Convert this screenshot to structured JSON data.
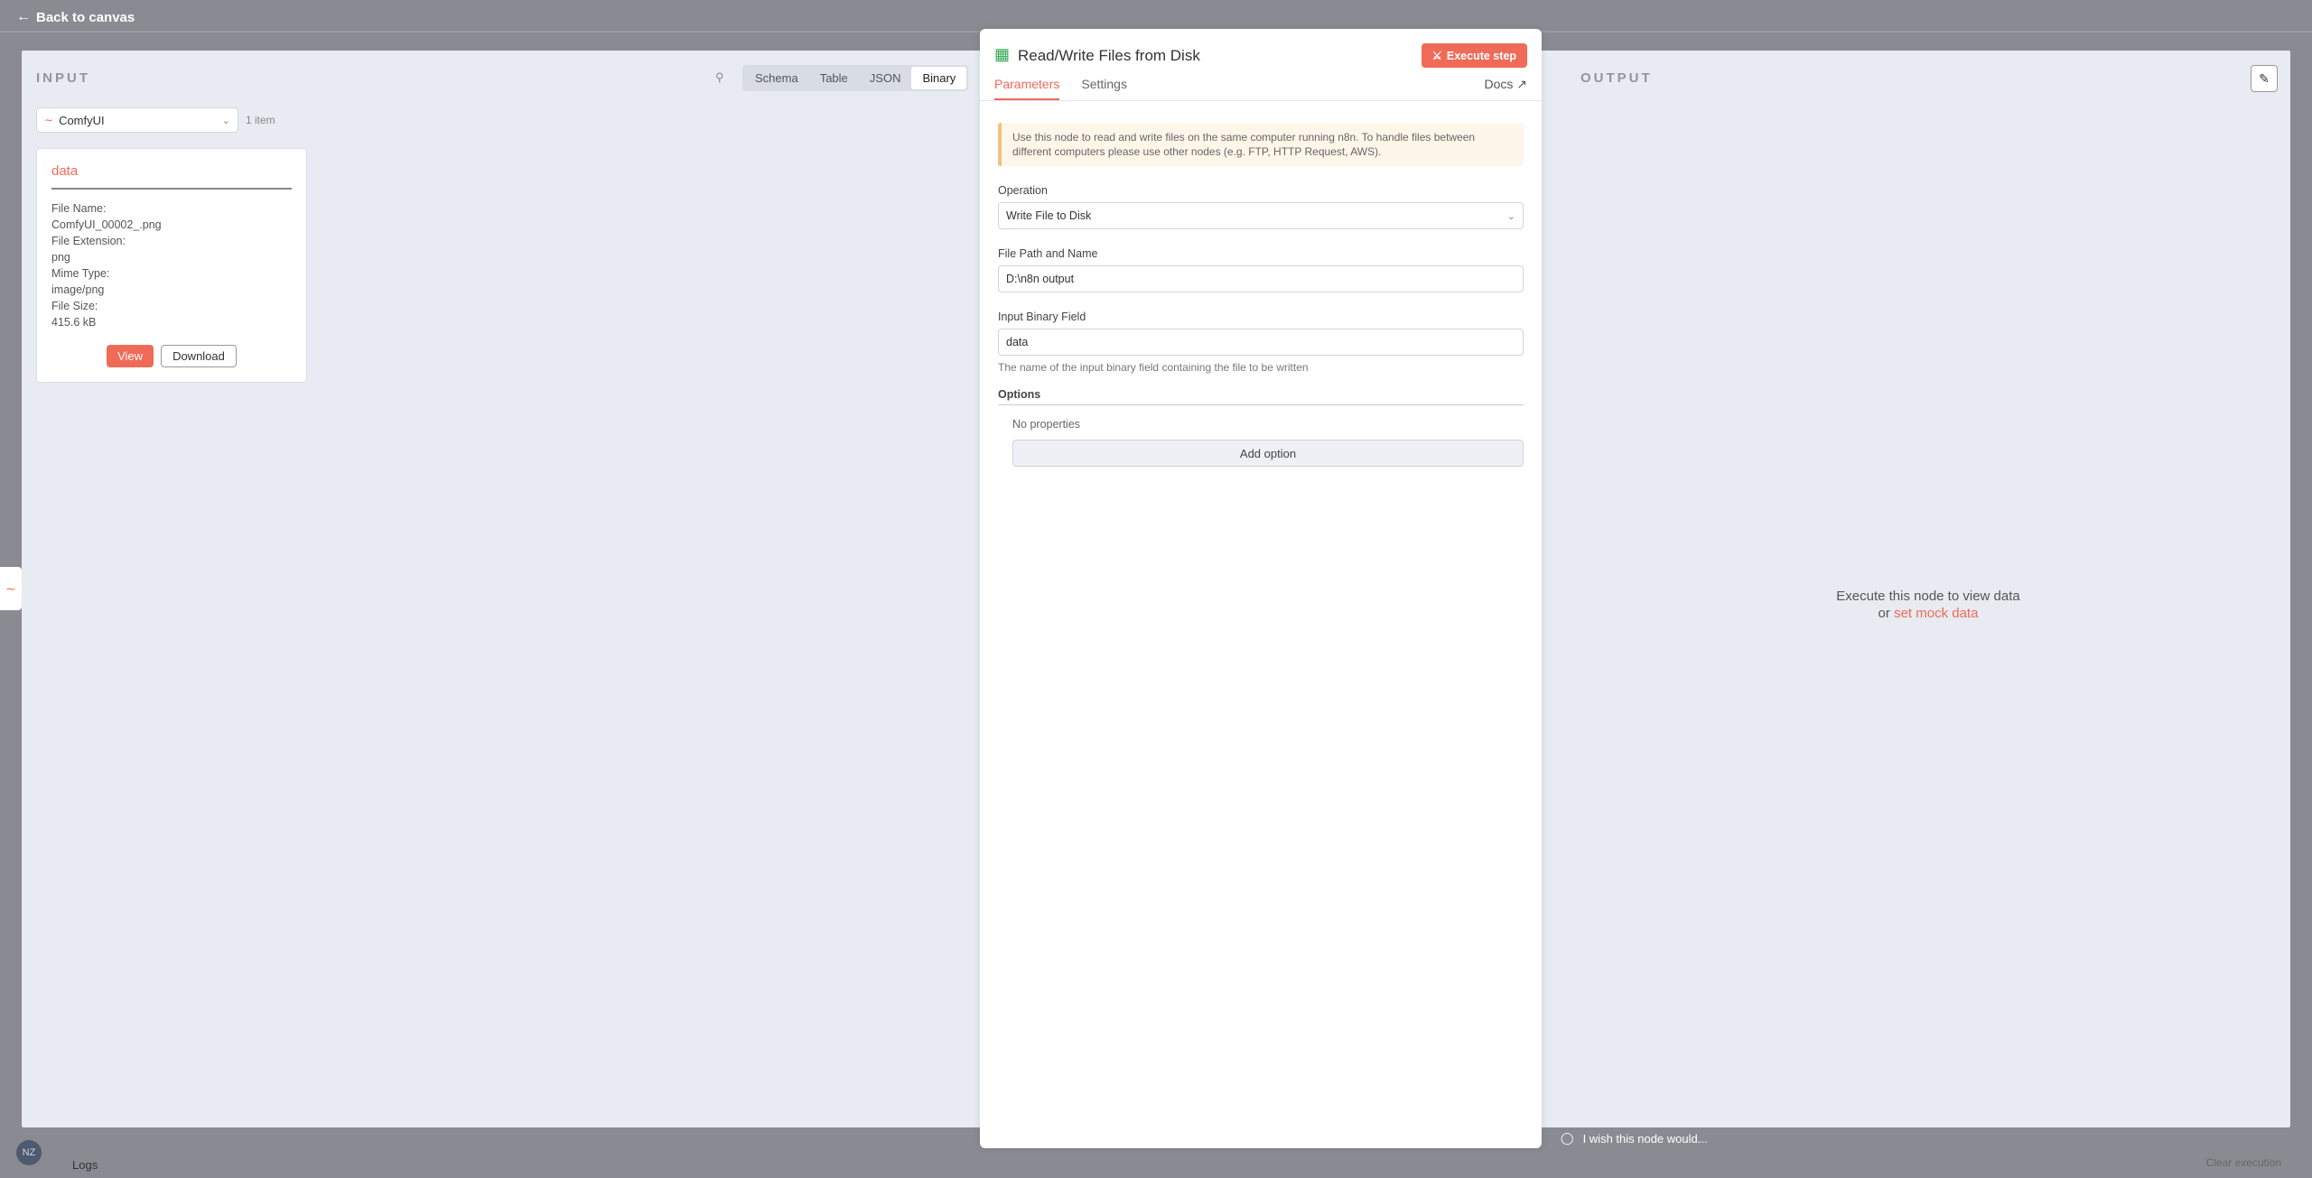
{
  "nav": {
    "back_label": "Back to canvas"
  },
  "input": {
    "title": "INPUT",
    "view_tabs": [
      "Schema",
      "Table",
      "JSON",
      "Binary"
    ],
    "active_tab": "Binary",
    "node_select": "ComfyUI",
    "items_count": "1 item",
    "card": {
      "title": "data",
      "file_name_label": "File Name:",
      "file_name": "ComfyUI_00002_.png",
      "file_ext_label": "File Extension:",
      "file_ext": "png",
      "mime_label": "Mime Type:",
      "mime": "image/png",
      "size_label": "File Size:",
      "size": "415.6 kB",
      "view_label": "View",
      "download_label": "Download"
    }
  },
  "params": {
    "node_title": "Read/Write Files from Disk",
    "execute_label": "Execute step",
    "tab_parameters": "Parameters",
    "tab_settings": "Settings",
    "docs_label": "Docs",
    "notice": "Use this node to read and write files on the same computer running n8n. To handle files between different computers please use other nodes (e.g. FTP, HTTP Request, AWS).",
    "operation_label": "Operation",
    "operation_value": "Write File to Disk",
    "path_label": "File Path and Name",
    "path_value": "D:\\n8n output",
    "binary_label": "Input Binary Field",
    "binary_value": "data",
    "binary_hint": "The name of the input binary field containing the file to be written",
    "options_label": "Options",
    "no_properties": "No properties",
    "add_option": "Add option"
  },
  "output": {
    "title": "OUTPUT",
    "msg_line1": "Execute this node to view data",
    "msg_or": "or ",
    "msg_link": "set mock data"
  },
  "footer": {
    "feedback": "I wish this node would...",
    "logs": "Logs",
    "clear": "Clear execution",
    "avatar": "NZ"
  },
  "colors": {
    "accent": "#ef6b58",
    "node_icon": "#2fa84f"
  }
}
